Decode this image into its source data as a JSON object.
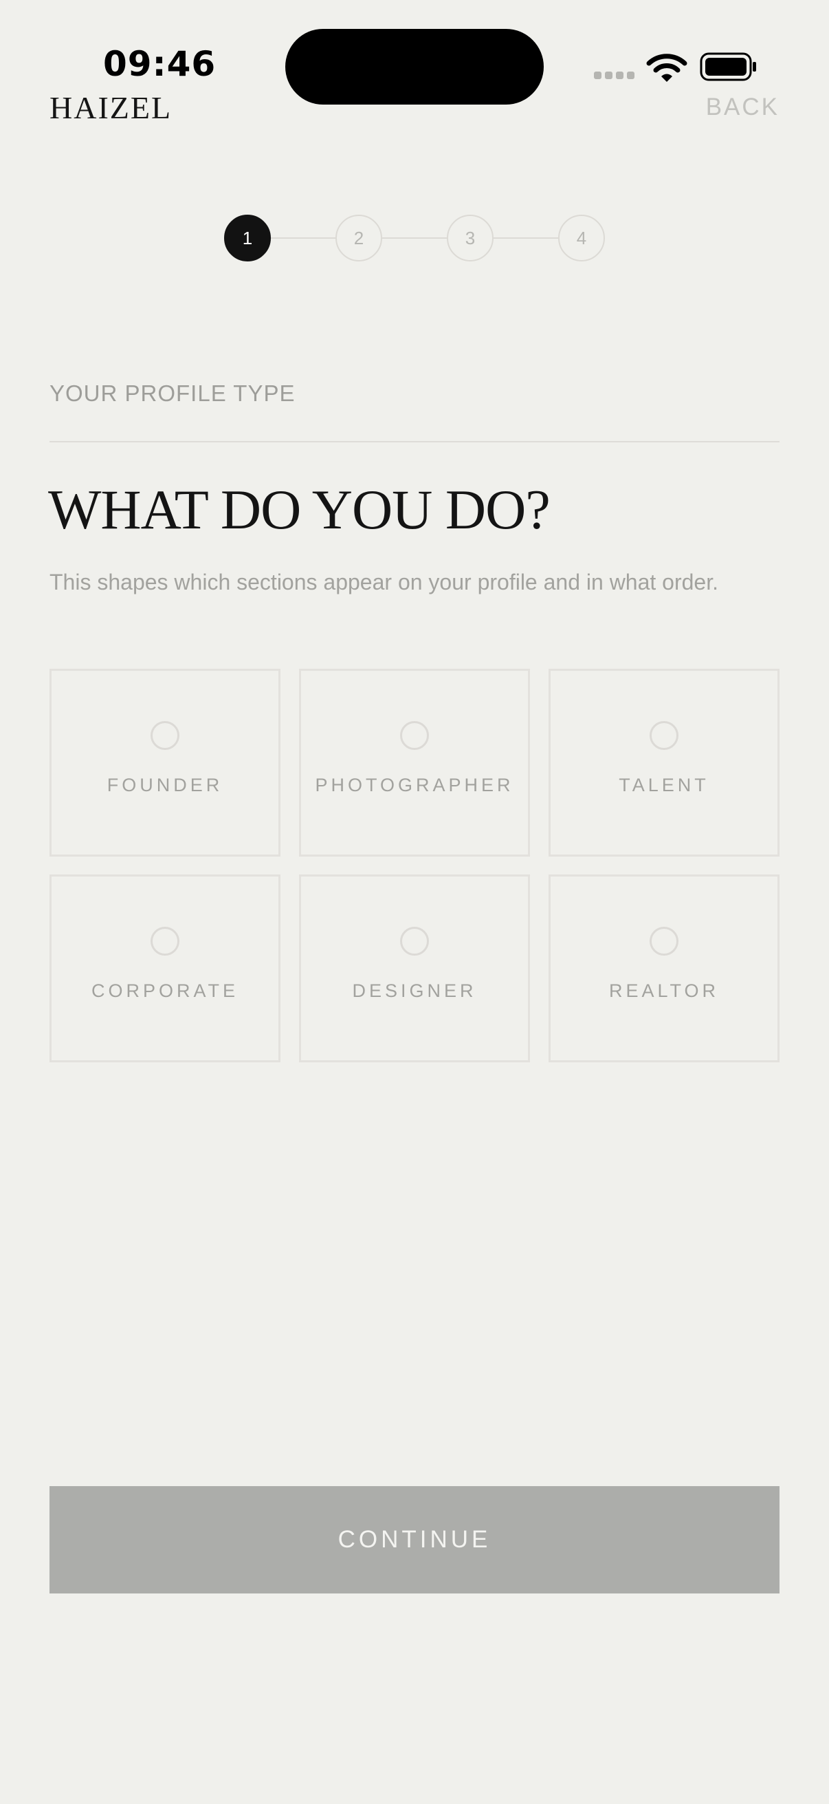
{
  "status_bar": {
    "time": "09:46",
    "icons": [
      "signal-icon",
      "wifi-icon",
      "battery-icon"
    ]
  },
  "header": {
    "brand": "HAIZEL",
    "back_label": "BACK"
  },
  "stepper": {
    "current_step": 1,
    "steps": [
      "1",
      "2",
      "3",
      "4"
    ]
  },
  "section": {
    "label": "YOUR PROFILE TYPE",
    "title": "WHAT DO YOU DO?",
    "subtitle": "This shapes which sections appear on your profile and in what order."
  },
  "options": [
    {
      "label": "FOUNDER",
      "selected": false
    },
    {
      "label": "PHOTOGRAPHER",
      "selected": false
    },
    {
      "label": "TALENT",
      "selected": false
    },
    {
      "label": "CORPORATE",
      "selected": false
    },
    {
      "label": "DESIGNER",
      "selected": false
    },
    {
      "label": "REALTOR",
      "selected": false
    }
  ],
  "footer": {
    "continue_label": "CONTINUE",
    "continue_enabled": false
  },
  "colors": {
    "background": "#f0f0ec",
    "primary": "#121212",
    "muted_text": "#a2a29e",
    "border": "#e3e1dd",
    "button_disabled": "#acadaa"
  }
}
